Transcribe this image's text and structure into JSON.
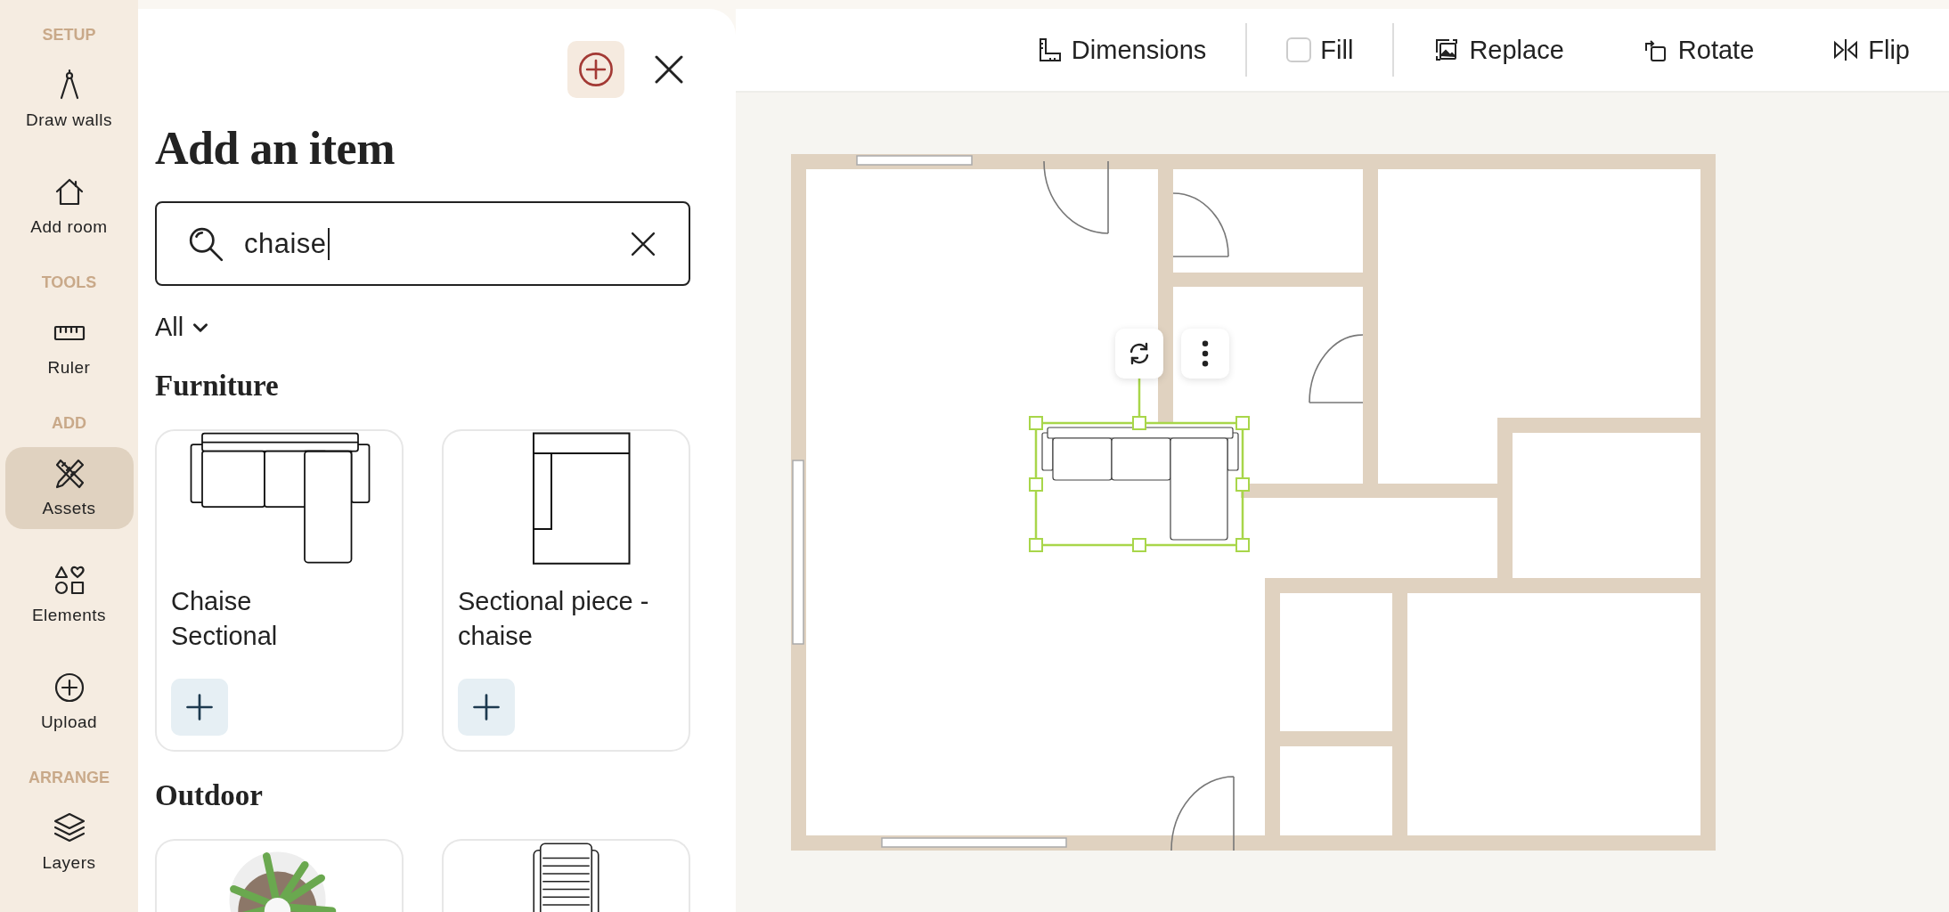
{
  "sidebar": {
    "sections": [
      {
        "label": "SETUP",
        "items": [
          {
            "label": "Draw walls",
            "selected": false
          },
          {
            "label": "Add room",
            "selected": false
          }
        ]
      },
      {
        "label": "TOOLS",
        "items": [
          {
            "label": "Ruler",
            "selected": false
          }
        ]
      },
      {
        "label": "ADD",
        "items": [
          {
            "label": "Assets",
            "selected": true
          },
          {
            "label": "Elements",
            "selected": false
          },
          {
            "label": "Upload",
            "selected": false
          }
        ]
      },
      {
        "label": "ARRANGE",
        "items": [
          {
            "label": "Layers",
            "selected": false
          }
        ]
      }
    ]
  },
  "panel": {
    "title": "Add an item",
    "search": {
      "value": "chaise"
    },
    "filter": {
      "label": "All"
    },
    "categories": [
      {
        "title": "Furniture",
        "items": [
          {
            "kind": "sectional",
            "name": "Chaise Sectional"
          },
          {
            "kind": "chaise",
            "name": "Sectional piece - chaise"
          }
        ]
      },
      {
        "title": "Outdoor",
        "items": [
          {
            "kind": "plant"
          },
          {
            "kind": "lounger"
          }
        ]
      }
    ]
  },
  "toolbar": {
    "items": [
      {
        "kind": "button",
        "label": "Dimensions"
      },
      {
        "kind": "checkbox",
        "label": "Fill",
        "checked": false
      },
      {
        "kind": "button",
        "label": "Replace"
      },
      {
        "kind": "button",
        "label": "Rotate"
      },
      {
        "kind": "button",
        "label": "Flip"
      }
    ]
  }
}
